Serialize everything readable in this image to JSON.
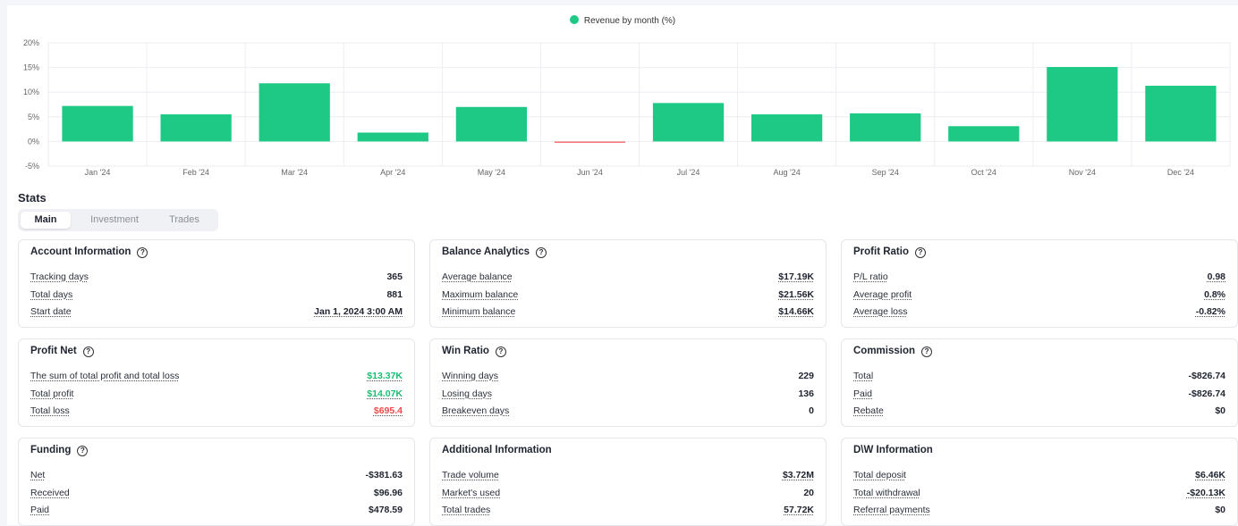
{
  "chart_data": {
    "type": "bar",
    "legend": "Revenue by month (%)",
    "categories": [
      "Jan '24",
      "Feb '24",
      "Mar '24",
      "Apr '24",
      "May '24",
      "Jun '24",
      "Jul '24",
      "Aug '24",
      "Sep '24",
      "Oct '24",
      "Nov '24",
      "Dec '24"
    ],
    "values": [
      7.2,
      5.5,
      11.8,
      1.8,
      7.0,
      -0.3,
      7.8,
      5.5,
      5.7,
      3.1,
      15.1,
      11.3
    ],
    "y_ticks": [
      "20%",
      "15%",
      "10%",
      "5%",
      "0%",
      "-5%"
    ],
    "ylim": [
      -5,
      20
    ],
    "colors": {
      "positive": "#1dc984",
      "negative": "#f27a7a"
    }
  },
  "stats": {
    "title": "Stats",
    "tabs": [
      "Main",
      "Investment",
      "Trades"
    ]
  },
  "cards": {
    "account": {
      "title": "Account Information",
      "rows": [
        {
          "label": "Tracking days",
          "value": "365"
        },
        {
          "label": "Total days",
          "value": "881"
        },
        {
          "label": "Start date",
          "value": "Jan 1, 2024 3:00 AM"
        }
      ]
    },
    "balance": {
      "title": "Balance Analytics",
      "rows": [
        {
          "label": "Average balance",
          "value": "$17.19K"
        },
        {
          "label": "Maximum balance",
          "value": "$21.56K"
        },
        {
          "label": "Minimum balance",
          "value": "$14.66K"
        }
      ]
    },
    "profit_ratio": {
      "title": "Profit Ratio",
      "rows": [
        {
          "label": "P/L ratio",
          "value": "0.98"
        },
        {
          "label": "Average profit",
          "value": "0.8%"
        },
        {
          "label": "Average loss",
          "value": "-0.82%"
        }
      ]
    },
    "profit_net": {
      "title": "Profit Net",
      "rows": [
        {
          "label": "The sum of total profit and total loss",
          "value": "$13.37K"
        },
        {
          "label": "Total profit",
          "value": "$14.07K"
        },
        {
          "label": "Total loss",
          "value": "$695.4"
        }
      ]
    },
    "win_ratio": {
      "title": "Win Ratio",
      "rows": [
        {
          "label": "Winning days",
          "value": "229"
        },
        {
          "label": "Losing days",
          "value": "136"
        },
        {
          "label": "Breakeven days",
          "value": "0"
        }
      ]
    },
    "commission": {
      "title": "Commission",
      "rows": [
        {
          "label": "Total",
          "value": "-$826.74"
        },
        {
          "label": "Paid",
          "value": "-$826.74"
        },
        {
          "label": "Rebate",
          "value": "$0"
        }
      ]
    },
    "funding": {
      "title": "Funding",
      "rows": [
        {
          "label": "Net",
          "value": "-$381.63"
        },
        {
          "label": "Received",
          "value": "$96.96"
        },
        {
          "label": "Paid",
          "value": "$478.59"
        }
      ]
    },
    "additional": {
      "title": "Additional Information",
      "rows": [
        {
          "label": "Trade volume",
          "value": "$3.72M"
        },
        {
          "label": "Market's used",
          "value": "20"
        },
        {
          "label": "Total trades",
          "value": "57.72K"
        }
      ]
    },
    "dw": {
      "title": "D\\W Information",
      "rows": [
        {
          "label": "Total deposit",
          "value": "$6.46K"
        },
        {
          "label": "Total withdrawal",
          "value": "-$20.13K"
        },
        {
          "label": "Referral payments",
          "value": "$0"
        }
      ]
    }
  },
  "icons": {
    "info": "?"
  }
}
